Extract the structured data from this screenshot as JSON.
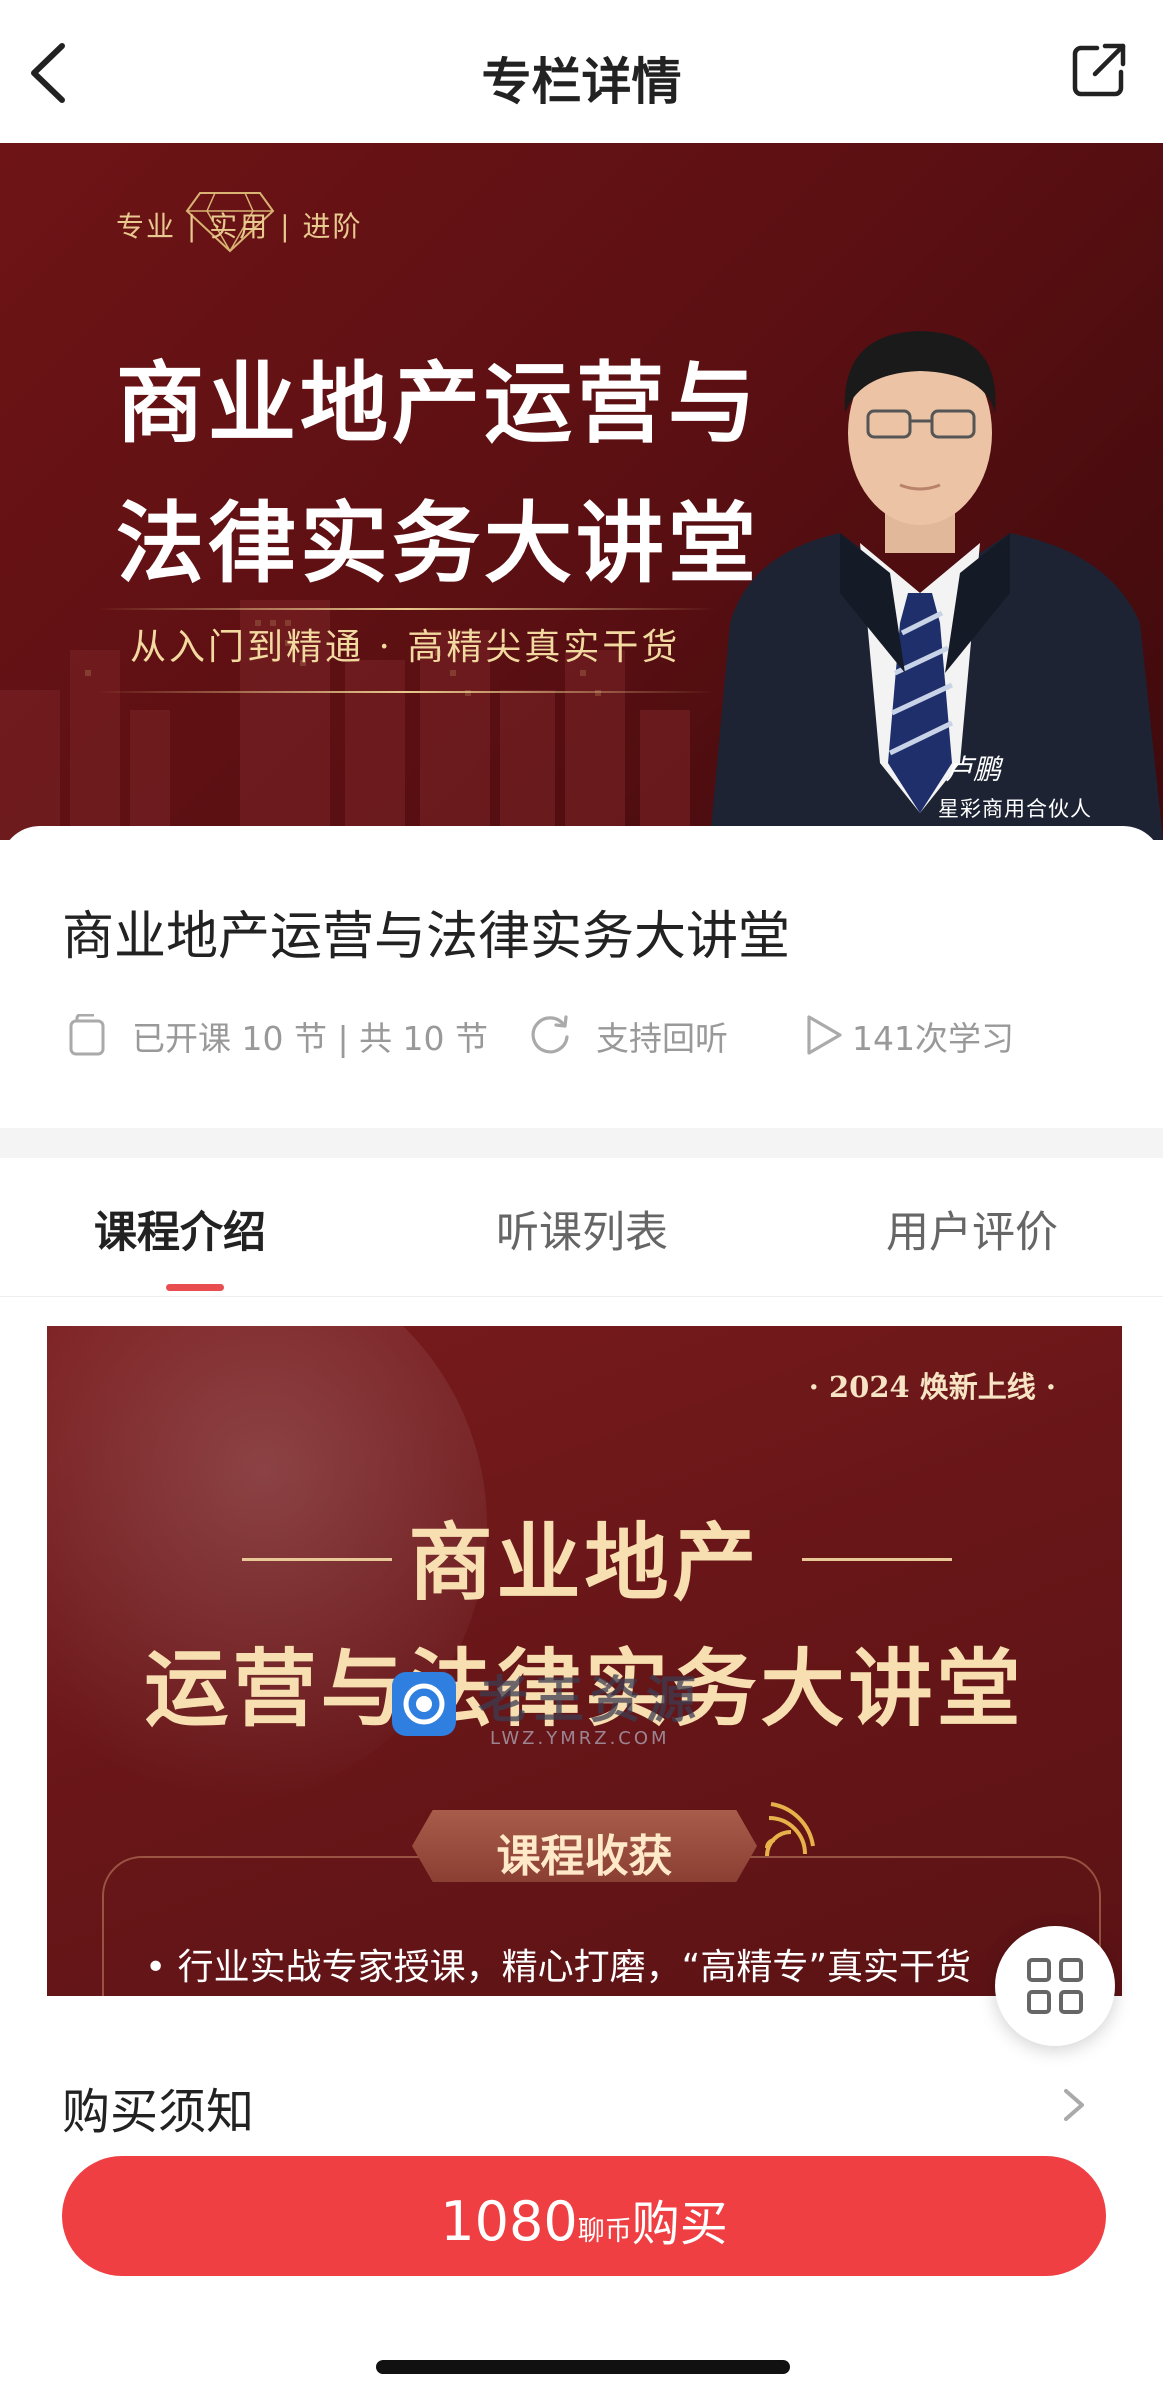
{
  "nav": {
    "title": "专栏详情",
    "back_icon": "chevron-left-icon",
    "share_icon": "share-external-icon"
  },
  "hero": {
    "tagline": "专业 | 实用 | 进阶",
    "title_line1": "商业地产运营与",
    "title_line2": "法律实务大讲堂",
    "subtitle": "从入门到精通 · 高精尖真实干货",
    "speaker_name": "卢鹏",
    "speaker_role": "星彩商用合伙人",
    "bg_color": "#5e1114",
    "accent_gold": "#e8c98f"
  },
  "course": {
    "title": "商业地产运营与法律实务大讲堂",
    "lessons_text": "已开课 10 节 | 共 10 节",
    "replay_text": "支持回听",
    "learners_text": "141次学习"
  },
  "tabs": [
    {
      "label": "课程介绍",
      "active": true
    },
    {
      "label": "听课列表",
      "active": false
    },
    {
      "label": "用户评价",
      "active": false
    }
  ],
  "poster": {
    "badge": "· 2024 焕新上线 ·",
    "heading_line1": "商业地产",
    "heading_line2": "运营与法律实务大讲堂",
    "section_label": "课程收获",
    "bullet": "• 行业实战专家授课，精心打磨，“高精专”真实干货"
  },
  "watermark": {
    "text": "老王资源",
    "url": "LWZ.YMRZ.COM"
  },
  "purchase_notice": {
    "label": "购买须知"
  },
  "buy_button": {
    "price": "1080",
    "unit": "聊币",
    "label": "购买",
    "color": "#ef3f42"
  },
  "accent_color": "#e84d4f"
}
